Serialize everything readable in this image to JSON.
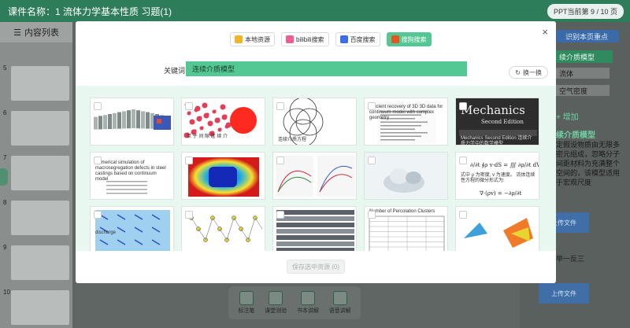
{
  "app": {
    "title": "课件名称：1 流体力学基本性质 习题(1)",
    "ppt_page": "PPT当前第 9 / 10 页",
    "content_list_title": "内容列表",
    "slide_numbers": [
      "5",
      "6",
      "7",
      "8",
      "9",
      "10"
    ]
  },
  "right_panel": {
    "identify_button": "识别本页重点",
    "green_item": "续介质模型",
    "items": [
      "流体",
      "空气密度"
    ],
    "add_label": "+ 增加",
    "section_heading": "续介质模型",
    "section_text": "定假设物质由无限多密元组成，忽略分子间距材料为充满整个空间的，该模型适用于宏观尺度",
    "upload_labels": [
      "上传文件",
      "上传文件"
    ],
    "one_more": "举一反三"
  },
  "toolbar": {
    "items": [
      "标注笔",
      "课堂测验",
      "书本讲解",
      "语音讲解"
    ]
  },
  "modal": {
    "close_icon": "×",
    "tabs": [
      {
        "label": "本地资源",
        "icon": "folder-icon",
        "color": "#f0b429"
      },
      {
        "label": "bilibili搜索",
        "icon": "bilibili-icon",
        "color": "#f25d8e"
      },
      {
        "label": "百度搜索",
        "icon": "baidu-icon",
        "color": "#3b6ee8"
      },
      {
        "label": "搜狗搜索",
        "icon": "sogou-icon",
        "color": "#e8531f"
      }
    ],
    "active_tab_index": 3,
    "keyword_label": "关键词",
    "keyword_value": "连续介质模型",
    "refresh_label": "换一换",
    "save_label": "保存选中资源 (0)",
    "results": [
      {
        "kind": "ring",
        "caption": ""
      },
      {
        "kind": "dots",
        "caption": "单 子 间 隙  连 续 介"
      },
      {
        "kind": "circles",
        "caption": "连续介质方程"
      },
      {
        "kind": "paper",
        "caption": "Efficient recovery of 3D 3D data for continuum model with complex geometry"
      },
      {
        "kind": "book",
        "caption": "Mechanics Second Edition 连续介质力学中的数学模型"
      },
      {
        "kind": "thesis",
        "caption": "Numerical simulation of macrosegregation defects in steel castings based on continuum model"
      },
      {
        "kind": "heatmap",
        "caption": ""
      },
      {
        "kind": "plots",
        "caption": ""
      },
      {
        "kind": "cloud",
        "caption": ""
      },
      {
        "kind": "formula",
        "caption": "式中 ρ 为密度, v 为速度。 流体连续性方程的微分形式为:"
      },
      {
        "kind": "arrows",
        "caption": "discharge"
      },
      {
        "kind": "network",
        "caption": ""
      },
      {
        "kind": "strips",
        "caption": ""
      },
      {
        "kind": "table",
        "caption": "Number of Percolation Clusters"
      },
      {
        "kind": "shapes",
        "caption": ""
      }
    ]
  },
  "colors": {
    "accent": "#54c894",
    "results_bg": "#e8f7f0",
    "topbar": "#2e7d5a"
  }
}
